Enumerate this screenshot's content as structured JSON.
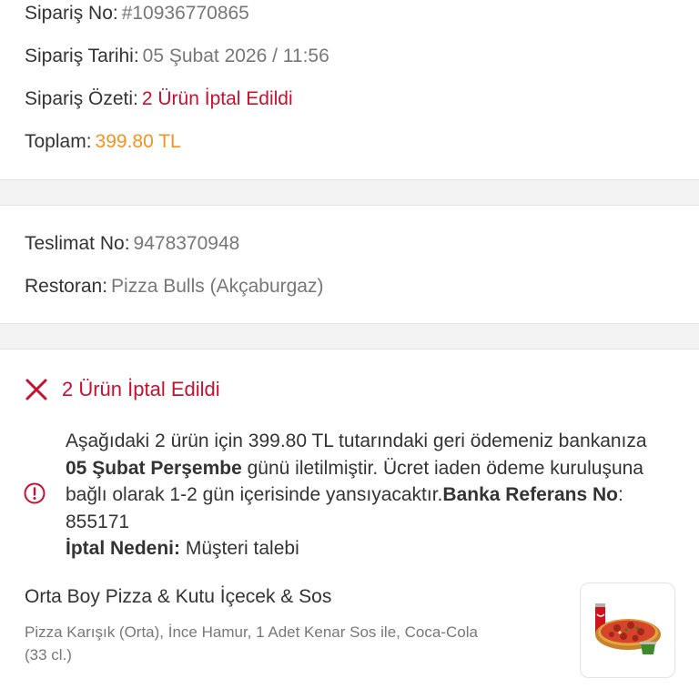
{
  "order": {
    "order_no_label": "Sipariş No:",
    "order_no_value": "#10936770865",
    "order_date_label": "Sipariş Tarihi:",
    "order_date_value": "05 Şubat 2026 / 11:56",
    "summary_label": "Sipariş Özeti:",
    "summary_value": "2 Ürün İptal Edildi",
    "total_label": "Toplam:",
    "total_value": "399.80 TL"
  },
  "delivery": {
    "delivery_no_label": "Teslimat No:",
    "delivery_no_value": "9478370948",
    "restaurant_label": "Restoran:",
    "restaurant_value": "Pizza Bulls (Akçaburgaz)"
  },
  "cancellation": {
    "heading": "2 Ürün İptal Edildi",
    "info_part1": "Aşağıdaki 2 ürün için 399.80 TL tutarındaki geri ödemeniz bankanıza ",
    "info_bold_date": "05 Şubat Perşembe",
    "info_part2": " günü iletilmiştir. Ücret iaden ödeme kuruluşuna bağlı olarak 1-2 gün içerisinde yansıyacaktır.",
    "bank_ref_label": "Banka Referans No",
    "bank_ref_value": ": 855171",
    "reason_label": "İptal Nedeni:",
    "reason_value": " Müşteri talebi"
  },
  "product": {
    "title": "Orta Boy Pizza & Kutu İçecek & Sos",
    "description": "Pizza Karışık (Orta), İnce Hamur, 1 Adet Kenar Sos ile, Coca-Cola (33 cl.)",
    "image_icon": "pizza-menu-icon"
  },
  "colors": {
    "red": "#c8102e",
    "orange": "#f39322",
    "gray_text": "#777777",
    "dark_text": "#333333"
  }
}
